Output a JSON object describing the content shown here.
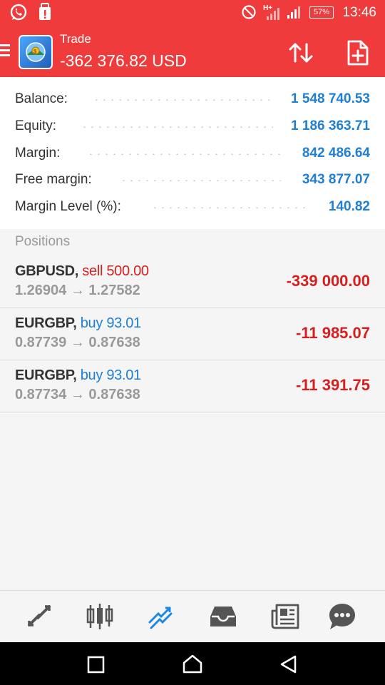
{
  "status_bar": {
    "battery": "57%",
    "time": "13:46",
    "icons": [
      "whatsapp-icon",
      "alert-icon",
      "dnd-icon",
      "hplus-signal-icon",
      "signal-icon",
      "battery-icon"
    ]
  },
  "header": {
    "title": "Trade",
    "value": "-362 376.82 USD",
    "icons": [
      "menu-icon",
      "metatrader-logo",
      "sort-icon",
      "new-order-icon"
    ]
  },
  "summary": [
    {
      "label": "Balance:",
      "value": "1 548 740.53"
    },
    {
      "label": "Equity:",
      "value": "1 186 363.71"
    },
    {
      "label": "Margin:",
      "value": "842 486.64"
    },
    {
      "label": "Free margin:",
      "value": "343 877.07"
    },
    {
      "label": "Margin Level (%):",
      "value": "140.82"
    }
  ],
  "positions_header": "Positions",
  "positions": [
    {
      "symbol": "GBPUSD",
      "side": "sell 500.00",
      "side_type": "sell",
      "open": "1.26904",
      "arrow": "→",
      "current": "1.27582",
      "profit": "-339 000.00"
    },
    {
      "symbol": "EURGBP",
      "side": "buy 93.01",
      "side_type": "buy",
      "open": "0.87739",
      "arrow": "→",
      "current": "0.87638",
      "profit": "-11 985.07"
    },
    {
      "symbol": "EURGBP",
      "side": "buy 93.01",
      "side_type": "buy",
      "open": "0.87734",
      "arrow": "→",
      "current": "0.87638",
      "profit": "-11 391.75"
    }
  ],
  "bottom_nav": [
    "quotes-icon",
    "chart-icon",
    "trade-icon",
    "history-icon",
    "news-icon",
    "chat-icon"
  ],
  "system_nav": [
    "recent-apps-icon",
    "home-icon",
    "back-icon"
  ],
  "colors": {
    "accent": "#ef3b3b",
    "blue": "#1e7fd4",
    "loss": "#d62020",
    "active_nav": "#1e88e5"
  }
}
